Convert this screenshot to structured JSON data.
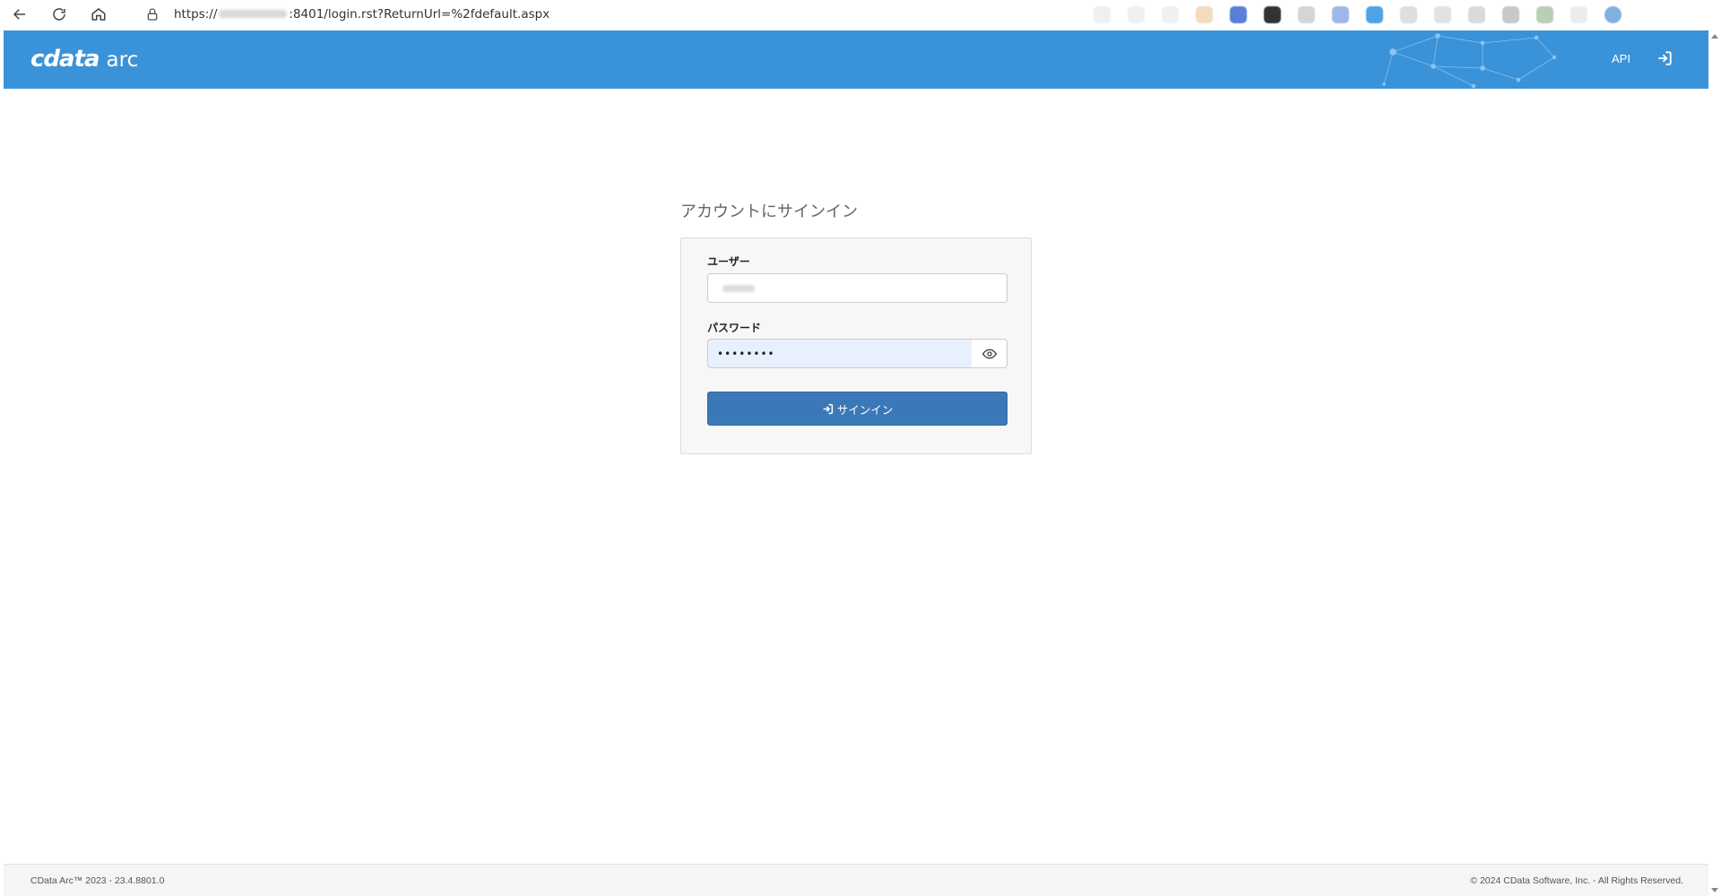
{
  "browser": {
    "url_prefix": "https://",
    "url_suffix": ":8401/login.rst?ReturnUrl=%2fdefault.aspx"
  },
  "header": {
    "logo_main": "cdata",
    "logo_sub": "arc",
    "api_label": "API",
    "bg_color": "#3a93d9"
  },
  "login": {
    "title": "アカウントにサインイン",
    "user_label": "ユーザー",
    "password_label": "パスワード",
    "password_value": "••••••••",
    "signin_button_label": "サインイン",
    "button_color": "#3b78b8"
  },
  "footer": {
    "version": "CData Arc™ 2023 - 23.4.8801.0",
    "copyright": "© 2024 CData Software, Inc. - All Rights Reserved."
  }
}
